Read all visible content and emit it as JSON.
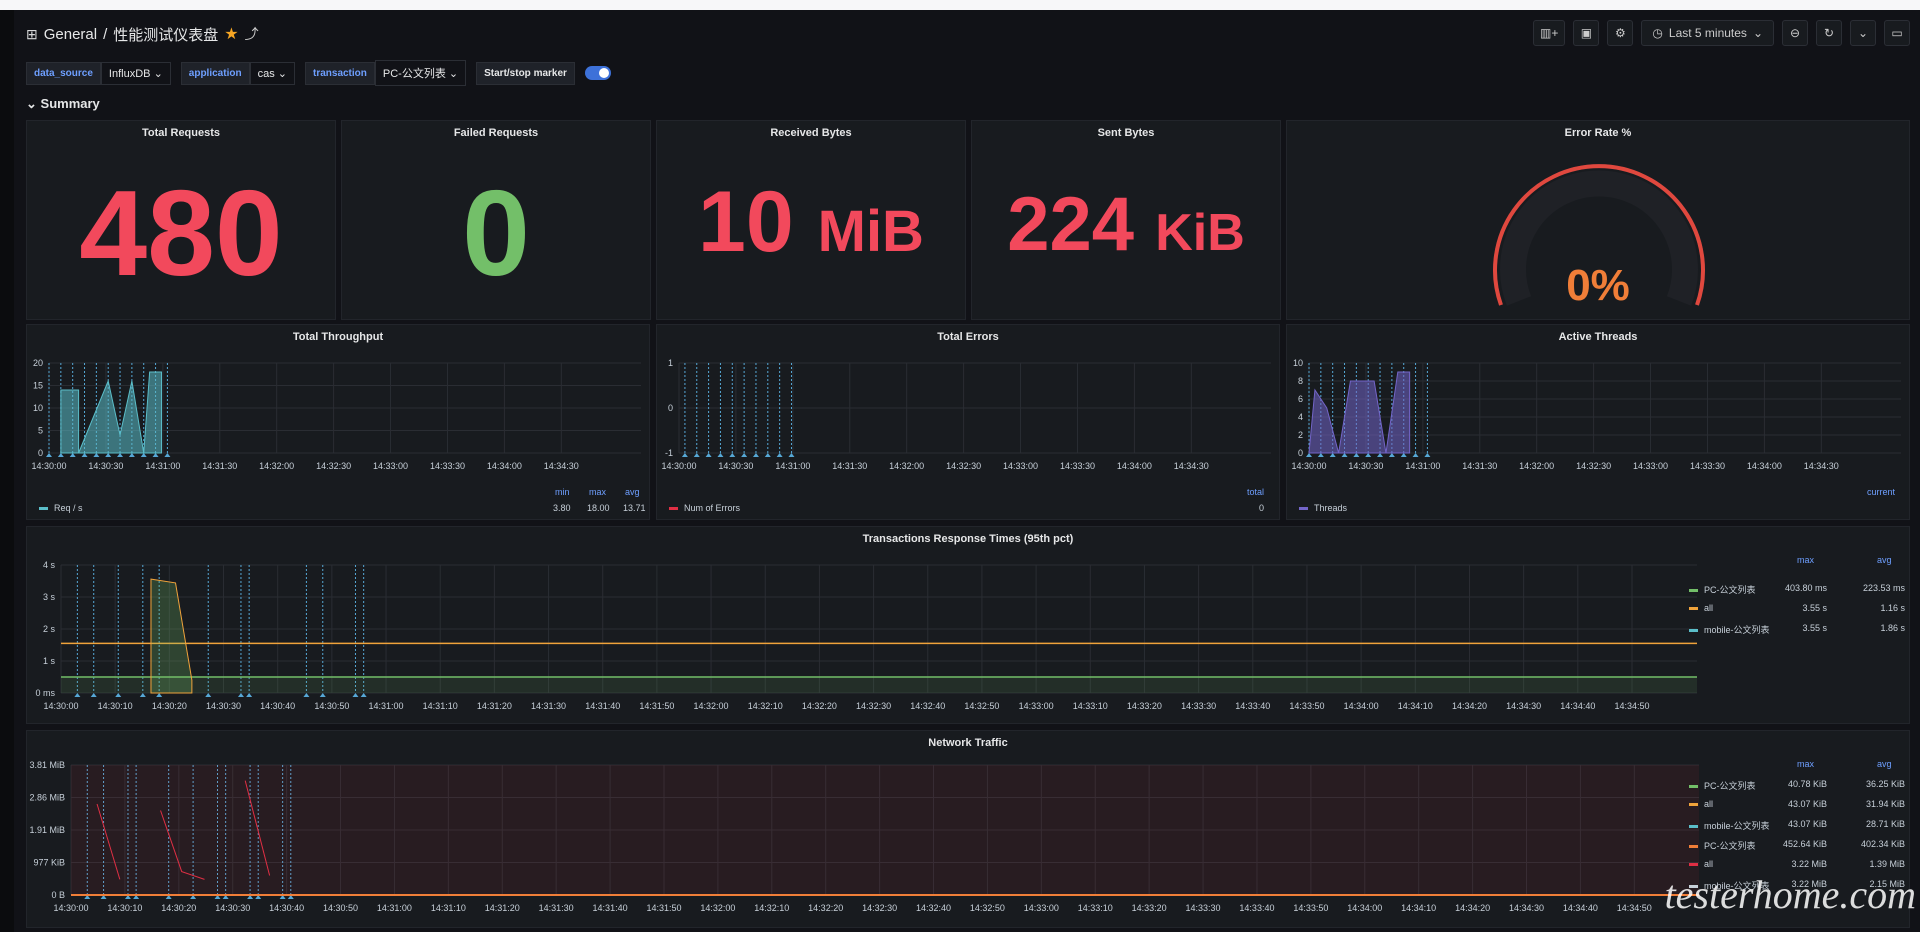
{
  "header": {
    "home": "General",
    "sep": "/",
    "title": "性能测试仪表盘"
  },
  "toolbar": {
    "time_range": "Last 5 minutes"
  },
  "vars": [
    {
      "label": "data_source",
      "value": "InfluxDB"
    },
    {
      "label": "application",
      "value": "cas"
    },
    {
      "label": "transaction",
      "value": "PC-公文列表"
    },
    {
      "label": "Start/stop marker",
      "value": ""
    }
  ],
  "summary_row": "Summary",
  "stats": {
    "total_requests": {
      "title": "Total Requests",
      "value": "480",
      "color": "#f2495c"
    },
    "failed_requests": {
      "title": "Failed Requests",
      "value": "0",
      "color": "#73bf69"
    },
    "received_bytes": {
      "title": "Received Bytes",
      "value": "10",
      "unit": "MiB",
      "color": "#f2495c"
    },
    "sent_bytes": {
      "title": "Sent Bytes",
      "value": "224",
      "unit": "KiB",
      "color": "#f2495c"
    },
    "error_rate": {
      "title": "Error Rate %",
      "value": "0%",
      "color": "#f07e38"
    }
  },
  "chart_data": [
    {
      "id": "throughput",
      "type": "area",
      "title": "Total Throughput",
      "x": [
        "14:30:00",
        "14:30:30",
        "14:31:00",
        "14:31:30",
        "14:32:00",
        "14:32:30",
        "14:33:00",
        "14:33:30",
        "14:34:00",
        "14:34:30"
      ],
      "ylim": [
        0,
        20
      ],
      "yticks": [
        "0",
        "5",
        "10",
        "15",
        "20"
      ],
      "series": [
        {
          "name": "Req / s",
          "color": "#5bbec9",
          "points": [
            [
              0.02,
              0
            ],
            [
              0.02,
              14
            ],
            [
              0.05,
              14
            ],
            [
              0.05,
              0
            ],
            [
              0.1,
              16
            ],
            [
              0.12,
              4
            ],
            [
              0.14,
              16
            ],
            [
              0.16,
              0
            ],
            [
              0.17,
              18
            ],
            [
              0.19,
              18
            ],
            [
              0.19,
              0
            ]
          ]
        }
      ],
      "legend": {
        "cols": [
          "min",
          "max",
          "avg"
        ],
        "rows": [
          [
            "Req / s",
            "3.80",
            "18.00",
            "13.71"
          ]
        ]
      }
    },
    {
      "id": "errors",
      "type": "line",
      "title": "Total Errors",
      "x": [
        "14:30:00",
        "14:30:30",
        "14:31:00",
        "14:31:30",
        "14:32:00",
        "14:32:30",
        "14:33:00",
        "14:33:30",
        "14:34:00",
        "14:34:30"
      ],
      "ylim": [
        -1,
        1
      ],
      "yticks": [
        "-1",
        "0",
        "1"
      ],
      "series": [
        {
          "name": "Num of Errors",
          "color": "#e02f44",
          "points": []
        }
      ],
      "legend": {
        "cols": [
          "total"
        ],
        "rows": [
          [
            "Num of Errors",
            "0"
          ]
        ]
      }
    },
    {
      "id": "threads",
      "type": "area",
      "title": "Active Threads",
      "x": [
        "14:30:00",
        "14:30:30",
        "14:31:00",
        "14:31:30",
        "14:32:00",
        "14:32:30",
        "14:33:00",
        "14:33:30",
        "14:34:00",
        "14:34:30"
      ],
      "ylim": [
        0,
        10
      ],
      "yticks": [
        "0",
        "2",
        "4",
        "6",
        "8",
        "10"
      ],
      "series": [
        {
          "name": "Threads",
          "color": "#7365c8",
          "points": [
            [
              0.0,
              0
            ],
            [
              0.01,
              7
            ],
            [
              0.03,
              5
            ],
            [
              0.05,
              0
            ],
            [
              0.07,
              8
            ],
            [
              0.11,
              8
            ],
            [
              0.13,
              0
            ],
            [
              0.15,
              9
            ],
            [
              0.17,
              9
            ],
            [
              0.17,
              0
            ]
          ]
        }
      ],
      "legend": {
        "cols": [
          "current"
        ],
        "rows": [
          [
            "Threads",
            ""
          ]
        ]
      }
    },
    {
      "id": "response",
      "type": "line",
      "title": "Transactions Response Times (95th pct)",
      "x": [
        "14:30:00",
        "14:30:10",
        "14:30:20",
        "14:30:30",
        "14:30:40",
        "14:30:50",
        "14:31:00",
        "14:31:10",
        "14:31:20",
        "14:31:30",
        "14:31:40",
        "14:31:50",
        "14:32:00",
        "14:32:10",
        "14:32:20",
        "14:32:30",
        "14:32:40",
        "14:32:50",
        "14:33:00",
        "14:33:10",
        "14:33:20",
        "14:33:30",
        "14:33:40",
        "14:33:50",
        "14:34:00",
        "14:34:10",
        "14:34:20",
        "14:34:30",
        "14:34:40",
        "14:34:50"
      ],
      "ylim": [
        0,
        4
      ],
      "yticks": [
        "0 ms",
        "1 s",
        "2 s",
        "3 s",
        "4 s"
      ],
      "series": [
        {
          "name": "PC-公文列表",
          "color": "#73bf69",
          "level": 0.5
        },
        {
          "name": "all",
          "color": "#f0a33b",
          "level": 1.55
        },
        {
          "name": "mobile-公文列表",
          "color": "#5bbec9",
          "level": null
        }
      ],
      "legend": {
        "cols": [
          "max",
          "avg"
        ],
        "rows": [
          [
            "PC-公文列表",
            "403.80 ms",
            "223.53 ms"
          ],
          [
            "all",
            "3.55 s",
            "1.16 s"
          ],
          [
            "mobile-公文列表",
            "3.55 s",
            "1.86 s"
          ]
        ]
      }
    },
    {
      "id": "network",
      "type": "line",
      "title": "Network Traffic",
      "x": [
        "14:30:00",
        "14:30:10",
        "14:30:20",
        "14:30:30",
        "14:30:40",
        "14:30:50",
        "14:31:00",
        "14:31:10",
        "14:31:20",
        "14:31:30",
        "14:31:40",
        "14:31:50",
        "14:32:00",
        "14:32:10",
        "14:32:20",
        "14:32:30",
        "14:32:40",
        "14:32:50",
        "14:33:00",
        "14:33:10",
        "14:33:20",
        "14:33:30",
        "14:33:40",
        "14:33:50",
        "14:34:00",
        "14:34:10",
        "14:34:20",
        "14:34:30",
        "14:34:40",
        "14:34:50"
      ],
      "ylim": [
        0,
        3.81
      ],
      "yticks": [
        "0 B",
        "977 KiB",
        "1.91 MiB",
        "2.86 MiB",
        "3.81 MiB"
      ],
      "series": [
        {
          "name": "PC-公文列表",
          "color": "#73bf69"
        },
        {
          "name": "all",
          "color": "#f0a33b"
        },
        {
          "name": "mobile-公文列表",
          "color": "#5bbec9"
        },
        {
          "name": "PC-公文列表",
          "color": "#f07e38"
        },
        {
          "name": "all",
          "color": "#e02f44"
        },
        {
          "name": "mobile-公文列表",
          "color": "#c7d0d9"
        }
      ],
      "legend": {
        "cols": [
          "max",
          "avg"
        ],
        "rows": [
          [
            "PC-公文列表",
            "40.78 KiB",
            "36.25 KiB"
          ],
          [
            "all",
            "43.07 KiB",
            "31.94 KiB"
          ],
          [
            "mobile-公文列表",
            "43.07 KiB",
            "28.71 KiB"
          ],
          [
            "PC-公文列表",
            "452.64 KiB",
            "402.34 KiB"
          ],
          [
            "all",
            "3.22 MiB",
            "1.39 MiB"
          ],
          [
            "mobile-公文列表",
            "3.22 MiB",
            "2.15 MiB"
          ]
        ]
      }
    }
  ],
  "watermark": "testerhome.com"
}
